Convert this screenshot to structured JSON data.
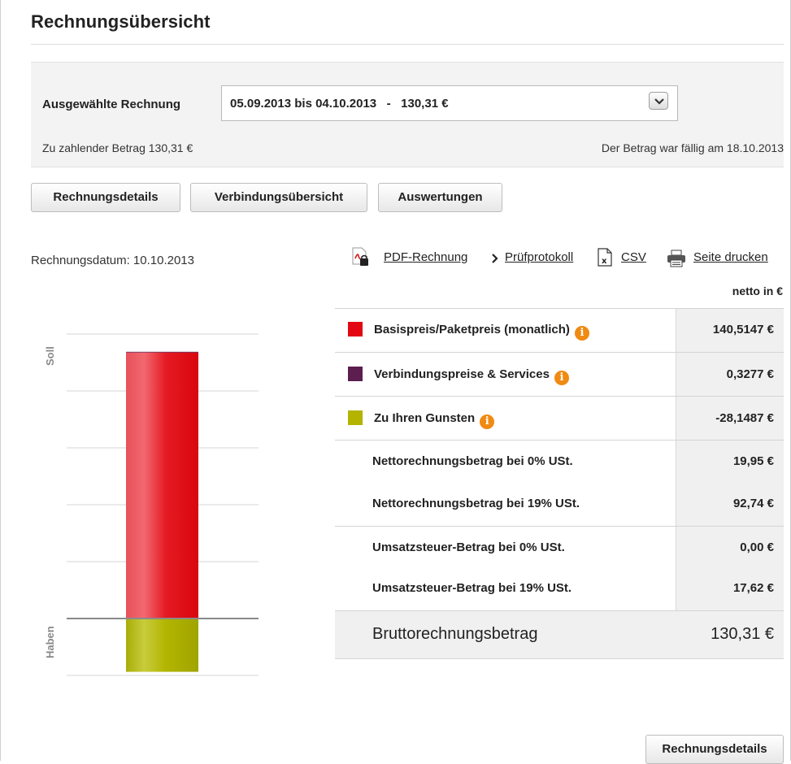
{
  "page": {
    "title": "Rechnungsübersicht"
  },
  "selection": {
    "label": "Ausgewählte Rechnung",
    "selected_value": "05.09.2013 bis 04.10.2013   -   130,31 €",
    "amount_due": "Zu zahlender Betrag 130,31 €",
    "due_date_text": "Der Betrag war fällig am 18.10.2013"
  },
  "tabs": {
    "details": "Rechnungsdetails",
    "connections": "Verbindungsübersicht",
    "analysis": "Auswertungen"
  },
  "invoice_date": "Rechnungsdatum: 10.10.2013",
  "links": {
    "pdf": "PDF-Rechnung",
    "audit": "Prüfprotokoll",
    "csv": "CSV",
    "print": "Seite drucken"
  },
  "table": {
    "column_header": "netto in €",
    "rows": [
      {
        "label": "Basispreis/Paketpreis (monatlich)",
        "value": "140,5147 €",
        "color": "#e30613",
        "info": true
      },
      {
        "label": "Verbindungspreise & Services",
        "value": "0,3277 €",
        "color": "#5b1e4e",
        "info": true
      },
      {
        "label": "Zu Ihren Gunsten",
        "value": "-28,1487 €",
        "color": "#b3b300",
        "info": true
      },
      {
        "label": "Nettorechnungsbetrag bei 0% USt.",
        "value": "19,95 €"
      },
      {
        "label": "Nettorechnungsbetrag bei 19% USt.",
        "value": "92,74 €"
      },
      {
        "label": "Umsatzsteuer-Betrag bei 0% USt.",
        "value": "0,00 €"
      },
      {
        "label": "Umsatzsteuer-Betrag bei 19% USt.",
        "value": "17,62 €"
      }
    ],
    "total": {
      "label": "Bruttorechnungsbetrag",
      "value": "130,31 €"
    }
  },
  "chart_data": {
    "type": "bar",
    "categories": [
      ""
    ],
    "series": [
      {
        "name": "Basispreis/Paketpreis (monatlich)",
        "values": [
          140.5147
        ],
        "color": "#e30613"
      },
      {
        "name": "Verbindungspreise & Services",
        "values": [
          0.3277
        ],
        "color": "#5b1e4e"
      },
      {
        "name": "Zu Ihren Gunsten",
        "values": [
          -28.1487
        ],
        "color": "#b3b300"
      }
    ],
    "axis_labels": {
      "positive": "Soll",
      "negative": "Haben"
    },
    "grid": true,
    "stacked": true
  },
  "footer": {
    "details_button": "Rechnungsdetails"
  }
}
